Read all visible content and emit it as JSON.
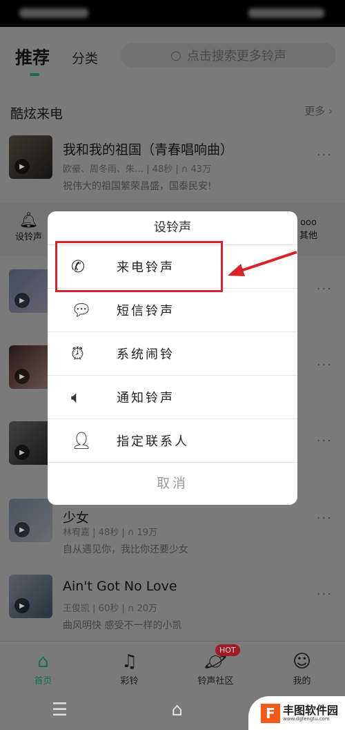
{
  "header": {
    "tabs": [
      {
        "label": "推荐",
        "active": true
      },
      {
        "label": "分类"
      }
    ],
    "search_placeholder": "点击搜索更多铃声"
  },
  "section": {
    "title": "酷炫来电",
    "more": "更多 ›"
  },
  "songs": [
    {
      "title": "我和我的祖国（青春唱响曲）",
      "artist": "欧豪、周冬雨、朱…",
      "duration": "48秒",
      "plays": "43万",
      "desc": "祝伟大的祖国繁荣昌盛，国泰民安!"
    },
    {
      "title": "少女",
      "artist": "林宥嘉",
      "duration": "48秒",
      "plays": "19万",
      "desc": "自从遇见你，我比你还要少女"
    },
    {
      "title": "Ain't Got No Love",
      "artist": "王俊凯",
      "duration": "60秒",
      "plays": "20万",
      "desc": "曲风明快  感受不一样的小凯"
    }
  ],
  "action_bar": {
    "left": "设铃声",
    "right": "其他"
  },
  "dialog": {
    "title": "设铃声",
    "items": [
      {
        "label": "来电铃声",
        "icon": "phone-ring-icon"
      },
      {
        "label": "短信铃声",
        "icon": "message-icon"
      },
      {
        "label": "系统闹铃",
        "icon": "alarm-clock-icon"
      },
      {
        "label": "通知铃声",
        "icon": "speaker-icon"
      },
      {
        "label": "指定联系人",
        "icon": "add-contact-icon"
      }
    ],
    "cancel": "取消"
  },
  "bottom_nav": [
    {
      "label": "首页",
      "active": true
    },
    {
      "label": "彩铃"
    },
    {
      "label": "铃声社区",
      "badge": "HOT"
    },
    {
      "label": "我的"
    }
  ],
  "watermark": {
    "name": "丰图软件园",
    "url": "www.dgfengtu.com"
  },
  "colors": {
    "accent": "#1a9a5c",
    "highlight": "#d9222a",
    "hot": "#e0263d"
  }
}
